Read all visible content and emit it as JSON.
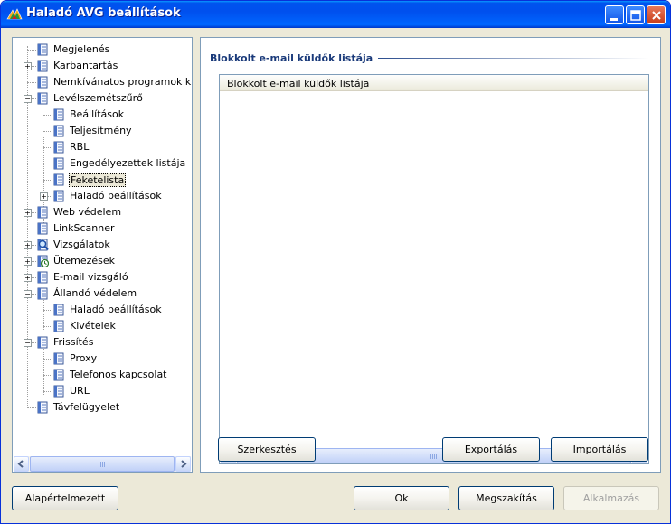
{
  "window": {
    "title": "Haladó AVG beállítások"
  },
  "tree": {
    "items": [
      {
        "label": "Megjelenés",
        "level": 0,
        "expander": "none"
      },
      {
        "label": "Karbantartás",
        "level": 0,
        "expander": "plus"
      },
      {
        "label": "Nemkívánatos programok kivételei",
        "level": 0,
        "expander": "none"
      },
      {
        "label": "Levélszemétszűrő",
        "level": 0,
        "expander": "minus"
      },
      {
        "label": "Beállítások",
        "level": 1,
        "expander": "none"
      },
      {
        "label": "Teljesítmény",
        "level": 1,
        "expander": "none"
      },
      {
        "label": "RBL",
        "level": 1,
        "expander": "none"
      },
      {
        "label": "Engedélyezettek listája",
        "level": 1,
        "expander": "none"
      },
      {
        "label": "Feketelista",
        "level": 1,
        "expander": "none",
        "selected": true
      },
      {
        "label": "Haladó beállítások",
        "level": 1,
        "expander": "plus"
      },
      {
        "label": "Web védelem",
        "level": 0,
        "expander": "plus"
      },
      {
        "label": "LinkScanner",
        "level": 0,
        "expander": "none"
      },
      {
        "label": "Vizsgálatok",
        "level": 0,
        "expander": "plus",
        "icon": "magnifier-icon"
      },
      {
        "label": "Ütemezések",
        "level": 0,
        "expander": "plus",
        "icon": "clock-icon"
      },
      {
        "label": "E-mail vizsgáló",
        "level": 0,
        "expander": "plus"
      },
      {
        "label": "Állandó védelem",
        "level": 0,
        "expander": "minus"
      },
      {
        "label": "Haladó beállítások",
        "level": 1,
        "expander": "none"
      },
      {
        "label": "Kivételek",
        "level": 1,
        "expander": "none"
      },
      {
        "label": "Frissítés",
        "level": 0,
        "expander": "minus"
      },
      {
        "label": "Proxy",
        "level": 1,
        "expander": "none"
      },
      {
        "label": "Telefonos kapcsolat",
        "level": 1,
        "expander": "none"
      },
      {
        "label": "URL",
        "level": 1,
        "expander": "none"
      },
      {
        "label": "Távfelügyelet",
        "level": 0,
        "expander": "none"
      }
    ]
  },
  "main": {
    "section_title": "Blokkolt e-mail küldők listája",
    "column_header": "Blokkolt e-mail küldők listája",
    "edit_button": "Szerkesztés",
    "export_button": "Exportálás",
    "import_button": "Importálás"
  },
  "footer": {
    "defaults_button": "Alapértelmezett",
    "ok_button": "Ok",
    "cancel_button": "Megszakítás",
    "apply_button": "Alkalmazás"
  },
  "colors": {
    "titlebar": "#0054e3",
    "section_title": "#1a3a7a",
    "disabled_text": "#a0a0a0"
  }
}
